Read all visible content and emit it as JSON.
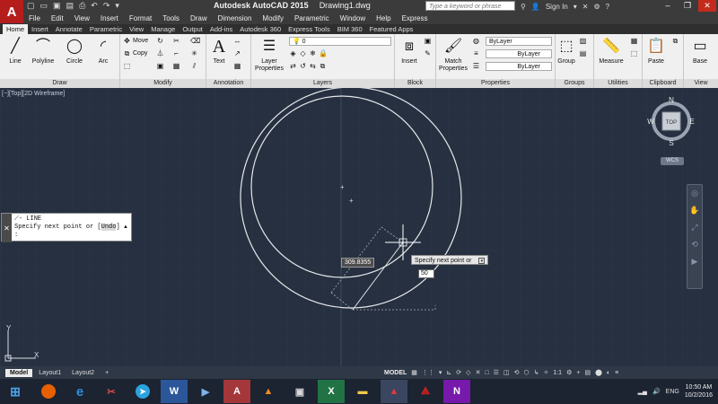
{
  "app": {
    "logo": "A",
    "title": "Autodesk AutoCAD 2015",
    "filename": "Drawing1.dwg",
    "search_placeholder": "Type a keyword or phrase",
    "signin": "Sign In"
  },
  "menu": [
    "File",
    "Edit",
    "View",
    "Insert",
    "Format",
    "Tools",
    "Draw",
    "Dimension",
    "Modify",
    "Parametric",
    "Window",
    "Help",
    "Express"
  ],
  "tabs": [
    "Home",
    "Insert",
    "Annotate",
    "Parametric",
    "View",
    "Manage",
    "Output",
    "Add-ins",
    "Autodesk 360",
    "Express Tools",
    "BIM 360",
    "Featured Apps"
  ],
  "ribbon": {
    "draw": {
      "title": "Draw",
      "line": "Line",
      "polyline": "Polyline",
      "circle": "Circle",
      "arc": "Arc"
    },
    "modify": {
      "title": "Modify",
      "move": "Move",
      "copy": "Copy"
    },
    "annotation": {
      "title": "Annotation",
      "text": "Text"
    },
    "layers": {
      "title": "Layers",
      "layer_properties": "Layer Properties",
      "current_layer": "0"
    },
    "block": {
      "title": "Block",
      "insert": "Insert"
    },
    "properties": {
      "title": "Properties",
      "match": "Match Properties",
      "color": "ByLayer",
      "linetype": "ByLayer",
      "lineweight": "ByLayer"
    },
    "groups": {
      "title": "Groups",
      "group": "Group"
    },
    "utilities": {
      "title": "Utilities",
      "measure": "Measure"
    },
    "clipboard": {
      "title": "Clipboard",
      "paste": "Paste"
    },
    "view": {
      "title": "View",
      "base": "Base"
    }
  },
  "viewport_label": "[−][Top][2D Wireframe]",
  "viewcube": {
    "top": "TOP",
    "n": "N",
    "s": "S",
    "e": "E",
    "w": "W",
    "wcs": "WCS"
  },
  "command": {
    "name": "- LINE",
    "prompt_start": "Specify next point or [",
    "prompt_option": "Undo",
    "prompt_end": "]",
    "input": ":"
  },
  "dynamic": {
    "distance": "309.8355",
    "tooltip": "Specify next point or",
    "input_value": "50"
  },
  "layout_tabs": [
    "Model",
    "Layout1",
    "Layout2",
    "+"
  ],
  "status": {
    "model": "MODEL",
    "scale": "1:1"
  },
  "taskbar": {
    "lang": "ENG",
    "time": "10:50 AM",
    "date": "10/2/2016"
  }
}
